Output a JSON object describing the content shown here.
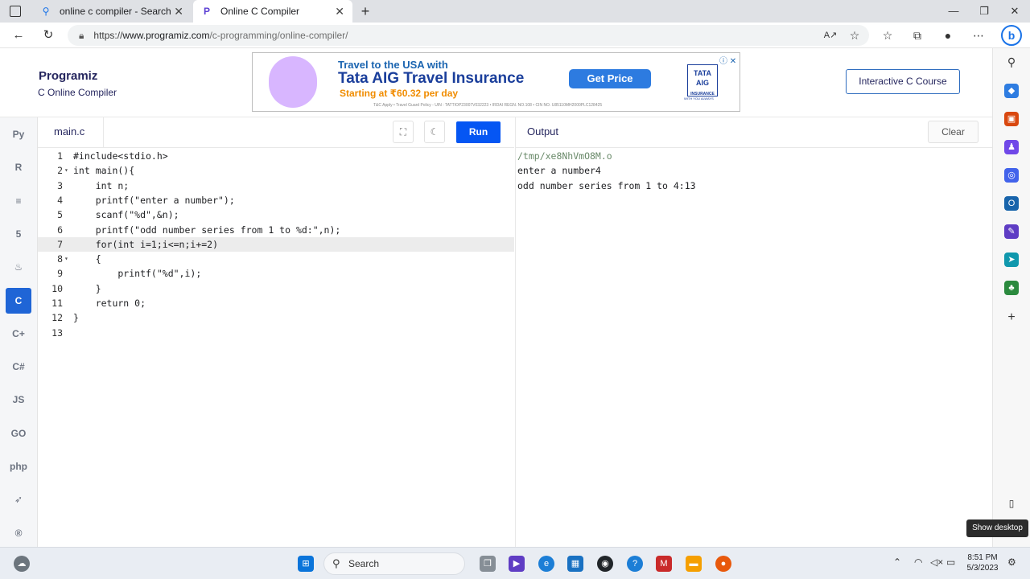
{
  "browser": {
    "tabs": [
      {
        "title": "online c compiler - Search",
        "favicon": "search-icon",
        "active": false
      },
      {
        "title": "Online C Compiler",
        "favicon": "programiz-icon",
        "active": true
      }
    ],
    "new_tab": "+",
    "address": {
      "host_prefix": "https://",
      "host": "www.programiz.com",
      "path": "/c-programming/online-compiler/"
    }
  },
  "header": {
    "logo": "Programiz",
    "subtitle": "C Online Compiler",
    "course_button": "Interactive C Course"
  },
  "ad": {
    "line1": "Travel to the USA with",
    "line2": "Tata AIG Travel Insurance",
    "line3": "Starting at ₹60.32 per day",
    "fine_print": "T&C Apply • Travel Guard Policy - UIN : TATTIOP23007V032223 • IRDAI REGN. NO.108 • CIN NO. U85110MH2000PLC128425",
    "cta": "Get Price",
    "brand": "TATA AIG",
    "brand_sub": "INSURANCE",
    "brand_tag": "WITH YOU ALWAYS"
  },
  "languages": [
    {
      "name": "python-icon",
      "glyph": "Py"
    },
    {
      "name": "r-icon",
      "glyph": "R"
    },
    {
      "name": "sql-icon",
      "glyph": "≡"
    },
    {
      "name": "html-icon",
      "glyph": "5"
    },
    {
      "name": "java-icon",
      "glyph": "♨"
    },
    {
      "name": "c-icon",
      "glyph": "C",
      "active": true
    },
    {
      "name": "cpp-icon",
      "glyph": "C+"
    },
    {
      "name": "csharp-icon",
      "glyph": "C#"
    },
    {
      "name": "js-icon",
      "glyph": "JS"
    },
    {
      "name": "go-icon",
      "glyph": "GO"
    },
    {
      "name": "php-icon",
      "glyph": "php"
    },
    {
      "name": "swift-icon",
      "glyph": "➶"
    },
    {
      "name": "rust-icon",
      "glyph": "®"
    }
  ],
  "editor": {
    "filename": "main.c",
    "run_label": "Run",
    "active_line": 7,
    "lines": [
      {
        "n": "1",
        "fold": "",
        "text": "#include<stdio.h>"
      },
      {
        "n": "2",
        "fold": "▾",
        "text": "int main(){"
      },
      {
        "n": "3",
        "fold": "",
        "text": "    int n;"
      },
      {
        "n": "4",
        "fold": "",
        "text": "    printf(\"enter a number\");"
      },
      {
        "n": "5",
        "fold": "",
        "text": "    scanf(\"%d\",&n);"
      },
      {
        "n": "6",
        "fold": "",
        "text": "    printf(\"odd number series from 1 to %d:\",n);"
      },
      {
        "n": "7",
        "fold": "",
        "text": "    for(int i=1;i<=n;i+=2)"
      },
      {
        "n": "8",
        "fold": "▾",
        "text": "    {"
      },
      {
        "n": "9",
        "fold": "",
        "text": "        printf(\"%d\",i);"
      },
      {
        "n": "10",
        "fold": "",
        "text": "    }"
      },
      {
        "n": "11",
        "fold": "",
        "text": "    return 0;"
      },
      {
        "n": "12",
        "fold": "",
        "text": "}"
      },
      {
        "n": "13",
        "fold": "",
        "text": ""
      }
    ]
  },
  "output": {
    "title": "Output",
    "clear_label": "Clear",
    "lines": [
      "/tmp/xe8NhVmO8M.o",
      "enter a number4",
      "odd number series from 1 to 4:13"
    ]
  },
  "taskbar": {
    "search_label": "Search",
    "time": "8:51 PM",
    "date": "5/3/2023",
    "show_desktop": "Show desktop"
  },
  "colors": {
    "accent": "#0556f3",
    "brand": "#25265e"
  }
}
